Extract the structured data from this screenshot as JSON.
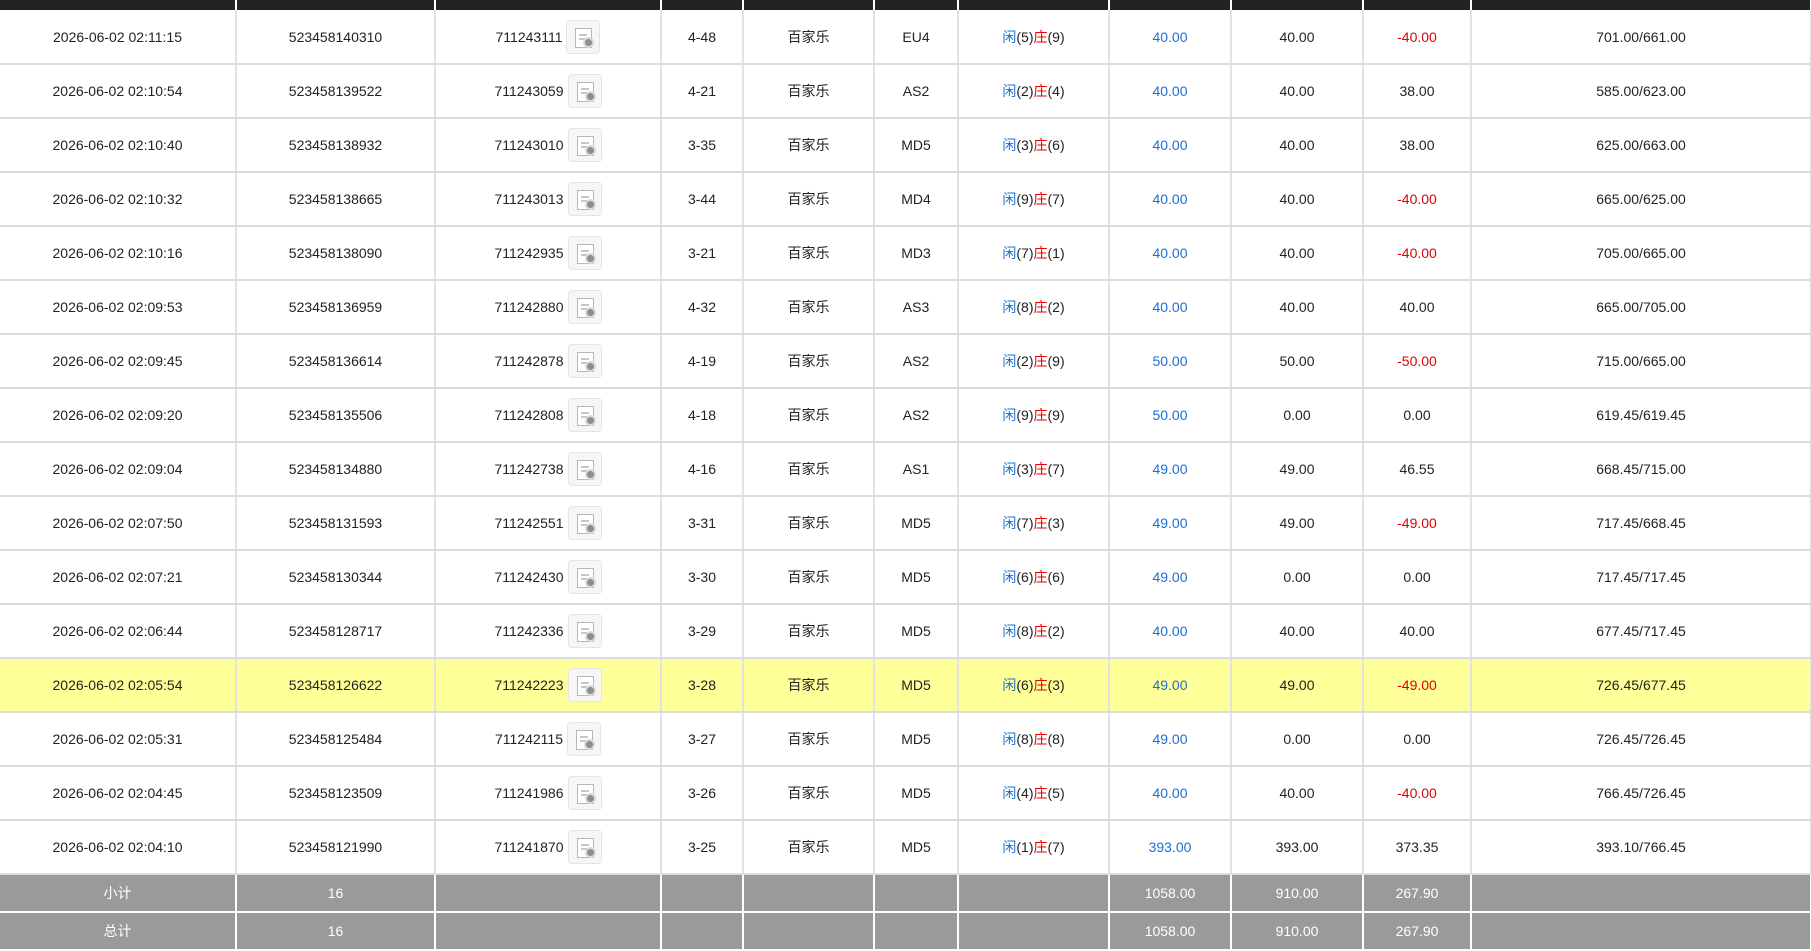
{
  "rows": [
    {
      "time": "2026-06-02 02:11:15",
      "bet_id": "523458140310",
      "round": "711243111",
      "shoe": "4-48",
      "game": "百家乐",
      "table": "EU4",
      "player_label": "闲",
      "player_score": "(5)",
      "banker_label": "庄",
      "banker_score": "(9)",
      "bet": "40.00",
      "valid": "40.00",
      "win": "-40.00",
      "win_color": "red",
      "balance": "701.00/661.00"
    },
    {
      "time": "2026-06-02 02:10:54",
      "bet_id": "523458139522",
      "round": "711243059",
      "shoe": "4-21",
      "game": "百家乐",
      "table": "AS2",
      "player_label": "闲",
      "player_score": "(2)",
      "banker_label": "庄",
      "banker_score": "(4)",
      "bet": "40.00",
      "valid": "40.00",
      "win": "38.00",
      "win_color": "black",
      "balance": "585.00/623.00"
    },
    {
      "time": "2026-06-02 02:10:40",
      "bet_id": "523458138932",
      "round": "711243010",
      "shoe": "3-35",
      "game": "百家乐",
      "table": "MD5",
      "player_label": "闲",
      "player_score": "(3)",
      "banker_label": "庄",
      "banker_score": "(6)",
      "bet": "40.00",
      "valid": "40.00",
      "win": "38.00",
      "win_color": "black",
      "balance": "625.00/663.00"
    },
    {
      "time": "2026-06-02 02:10:32",
      "bet_id": "523458138665",
      "round": "711243013",
      "shoe": "3-44",
      "game": "百家乐",
      "table": "MD4",
      "player_label": "闲",
      "player_score": "(9)",
      "banker_label": "庄",
      "banker_score": "(7)",
      "bet": "40.00",
      "valid": "40.00",
      "win": "-40.00",
      "win_color": "red",
      "balance": "665.00/625.00"
    },
    {
      "time": "2026-06-02 02:10:16",
      "bet_id": "523458138090",
      "round": "711242935",
      "shoe": "3-21",
      "game": "百家乐",
      "table": "MD3",
      "player_label": "闲",
      "player_score": "(7)",
      "banker_label": "庄",
      "banker_score": "(1)",
      "bet": "40.00",
      "valid": "40.00",
      "win": "-40.00",
      "win_color": "red",
      "balance": "705.00/665.00"
    },
    {
      "time": "2026-06-02 02:09:53",
      "bet_id": "523458136959",
      "round": "711242880",
      "shoe": "4-32",
      "game": "百家乐",
      "table": "AS3",
      "player_label": "闲",
      "player_score": "(8)",
      "banker_label": "庄",
      "banker_score": "(2)",
      "bet": "40.00",
      "valid": "40.00",
      "win": "40.00",
      "win_color": "black",
      "balance": "665.00/705.00"
    },
    {
      "time": "2026-06-02 02:09:45",
      "bet_id": "523458136614",
      "round": "711242878",
      "shoe": "4-19",
      "game": "百家乐",
      "table": "AS2",
      "player_label": "闲",
      "player_score": "(2)",
      "banker_label": "庄",
      "banker_score": "(9)",
      "bet": "50.00",
      "valid": "50.00",
      "win": "-50.00",
      "win_color": "red",
      "balance": "715.00/665.00"
    },
    {
      "time": "2026-06-02 02:09:20",
      "bet_id": "523458135506",
      "round": "711242808",
      "shoe": "4-18",
      "game": "百家乐",
      "table": "AS2",
      "player_label": "闲",
      "player_score": "(9)",
      "banker_label": "庄",
      "banker_score": "(9)",
      "bet": "50.00",
      "valid": "0.00",
      "win": "0.00",
      "win_color": "black",
      "balance": "619.45/619.45"
    },
    {
      "time": "2026-06-02 02:09:04",
      "bet_id": "523458134880",
      "round": "711242738",
      "shoe": "4-16",
      "game": "百家乐",
      "table": "AS1",
      "player_label": "闲",
      "player_score": "(3)",
      "banker_label": "庄",
      "banker_score": "(7)",
      "bet": "49.00",
      "valid": "49.00",
      "win": "46.55",
      "win_color": "black",
      "balance": "668.45/715.00"
    },
    {
      "time": "2026-06-02 02:07:50",
      "bet_id": "523458131593",
      "round": "711242551",
      "shoe": "3-31",
      "game": "百家乐",
      "table": "MD5",
      "player_label": "闲",
      "player_score": "(7)",
      "banker_label": "庄",
      "banker_score": "(3)",
      "bet": "49.00",
      "valid": "49.00",
      "win": "-49.00",
      "win_color": "red",
      "balance": "717.45/668.45"
    },
    {
      "time": "2026-06-02 02:07:21",
      "bet_id": "523458130344",
      "round": "711242430",
      "shoe": "3-30",
      "game": "百家乐",
      "table": "MD5",
      "player_label": "闲",
      "player_score": "(6)",
      "banker_label": "庄",
      "banker_score": "(6)",
      "bet": "49.00",
      "valid": "0.00",
      "win": "0.00",
      "win_color": "black",
      "balance": "717.45/717.45"
    },
    {
      "time": "2026-06-02 02:06:44",
      "bet_id": "523458128717",
      "round": "711242336",
      "shoe": "3-29",
      "game": "百家乐",
      "table": "MD5",
      "player_label": "闲",
      "player_score": "(8)",
      "banker_label": "庄",
      "banker_score": "(2)",
      "bet": "40.00",
      "valid": "40.00",
      "win": "40.00",
      "win_color": "black",
      "balance": "677.45/717.45"
    },
    {
      "time": "2026-06-02 02:05:54",
      "bet_id": "523458126622",
      "round": "711242223",
      "shoe": "3-28",
      "game": "百家乐",
      "table": "MD5",
      "player_label": "闲",
      "player_score": "(6)",
      "banker_label": "庄",
      "banker_score": "(3)",
      "bet": "49.00",
      "valid": "49.00",
      "win": "-49.00",
      "win_color": "red",
      "balance": "726.45/677.45",
      "highlight": true
    },
    {
      "time": "2026-06-02 02:05:31",
      "bet_id": "523458125484",
      "round": "711242115",
      "shoe": "3-27",
      "game": "百家乐",
      "table": "MD5",
      "player_label": "闲",
      "player_score": "(8)",
      "banker_label": "庄",
      "banker_score": "(8)",
      "bet": "49.00",
      "valid": "0.00",
      "win": "0.00",
      "win_color": "black",
      "balance": "726.45/726.45"
    },
    {
      "time": "2026-06-02 02:04:45",
      "bet_id": "523458123509",
      "round": "711241986",
      "shoe": "3-26",
      "game": "百家乐",
      "table": "MD5",
      "player_label": "闲",
      "player_score": "(4)",
      "banker_label": "庄",
      "banker_score": "(5)",
      "bet": "40.00",
      "valid": "40.00",
      "win": "-40.00",
      "win_color": "red",
      "balance": "766.45/726.45"
    },
    {
      "time": "2026-06-02 02:04:10",
      "bet_id": "523458121990",
      "round": "711241870",
      "shoe": "3-25",
      "game": "百家乐",
      "table": "MD5",
      "player_label": "闲",
      "player_score": "(1)",
      "banker_label": "庄",
      "banker_score": "(7)",
      "bet": "393.00",
      "valid": "393.00",
      "win": "373.35",
      "win_color": "black",
      "balance": "393.10/766.45"
    }
  ],
  "summary": [
    {
      "label": "小计",
      "count": "16",
      "bet": "1058.00",
      "valid": "910.00",
      "win": "267.90"
    },
    {
      "label": "总计",
      "count": "16",
      "bet": "1058.00",
      "valid": "910.00",
      "win": "267.90"
    }
  ],
  "colors": {
    "blue": "#1a6fd6",
    "red": "#e00000",
    "highlight": "#ffff99",
    "summary_bg": "#9a9a9a",
    "header_bar": "#222222"
  },
  "icons": {
    "round_detail": "video-replay-icon"
  }
}
